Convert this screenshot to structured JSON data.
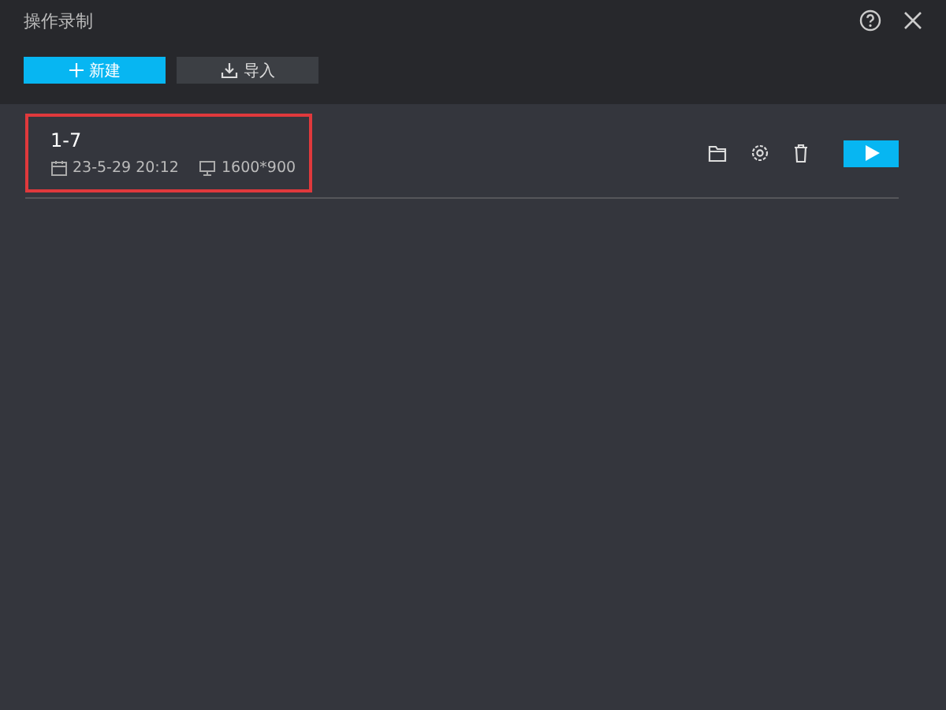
{
  "window": {
    "title": "操作录制"
  },
  "toolbar": {
    "buttons": [
      {
        "label": "新建",
        "kind": "primary"
      },
      {
        "label": "导入",
        "kind": "secondary"
      }
    ]
  },
  "recordings": [
    {
      "name": "1-7",
      "date": "23-5-29  20:12",
      "resolution": "1600*900",
      "highlighted": true
    }
  ]
}
